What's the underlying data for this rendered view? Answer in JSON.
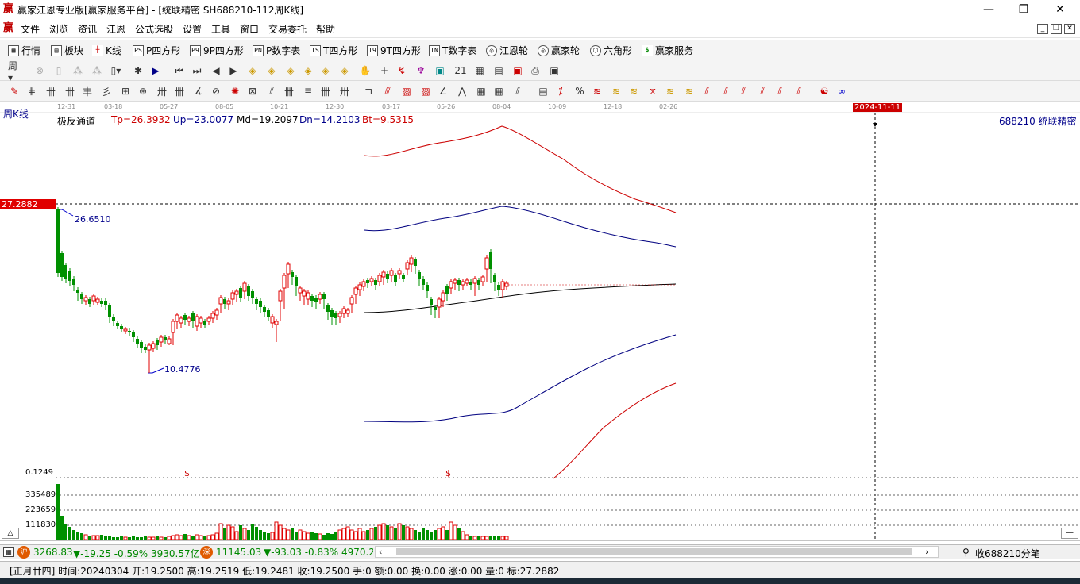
{
  "window": {
    "title": "赢家江恩专业版[赢家服务平台] - [统联精密  SH688210-112周K线]",
    "minimize": "—",
    "maximize": "❐",
    "close": "✕"
  },
  "menu": [
    "文件",
    "浏览",
    "资讯",
    "江恩",
    "公式选股",
    "设置",
    "工具",
    "窗口",
    "交易委托",
    "帮助"
  ],
  "toolbar1": [
    {
      "label": "行情",
      "icon": "grid-icon"
    },
    {
      "label": "板块",
      "icon": "blocks-icon"
    },
    {
      "label": "K线",
      "icon": "kline-icon"
    },
    {
      "label": "P四方形",
      "icon_text": "PS"
    },
    {
      "label": "9P四方形",
      "icon_text": "P9"
    },
    {
      "label": "P数字表",
      "icon_text": "PN"
    },
    {
      "label": "T四方形",
      "icon_text": "TS"
    },
    {
      "label": "9T四方形",
      "icon_text": "T9"
    },
    {
      "label": "T数字表",
      "icon_text": "TN"
    },
    {
      "label": "江恩轮",
      "icon": "wheel-icon"
    },
    {
      "label": "赢家轮",
      "icon": "wheel-icon"
    },
    {
      "label": "六角形",
      "icon": "hexagon-icon"
    },
    {
      "label": "赢家服务",
      "icon": "dollar-icon"
    }
  ],
  "chart": {
    "period_label": "周K线",
    "indicator_name": "极反通道",
    "tp": "Tp=26.3932",
    "up": "Up=23.0077",
    "md": "Md=19.2097",
    "dn": "Dn=14.2103",
    "bt": "Bt=9.5315",
    "stock_code_name": "688210  统联精密",
    "price_tag": "27.2882",
    "cursor_date": "2024-11-11",
    "high_label": "26.6510",
    "low_label": "10.4776",
    "dates": [
      "12-31",
      "03-18",
      "05-27",
      "08-05",
      "10-21",
      "12-30",
      "03-17",
      "05-26",
      "08-04",
      "10-09",
      "12-18",
      "02-26"
    ],
    "vol_labels": [
      "0.1249",
      "335489",
      "223659",
      "111830"
    ],
    "dollar_marker": "$",
    "colors": {
      "up": "#e00000",
      "down": "#009000",
      "upper": "#cc0000",
      "mid_band": "#000080",
      "md": "#000000"
    }
  },
  "status1": {
    "index1_value": "3268.83",
    "index1_change": "▼-19.25 -0.59% 3930.57亿",
    "index2_value": "11145.03",
    "index2_change": "▼-93.03 -0.83% 4970.20",
    "right_text": "收688210分笔"
  },
  "status2": {
    "text": "[正月廿四] 时间:20240304 开:19.2500 高:19.2519 低:19.2481 收:19.2500 手:0 额:0.00 换:0.00 涨:0.00 量:0 标:27.2882"
  }
}
